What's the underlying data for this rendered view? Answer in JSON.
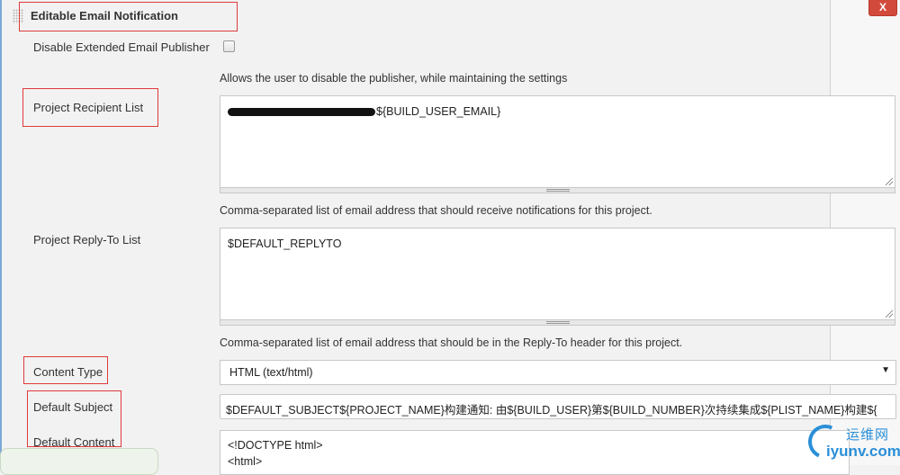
{
  "section": {
    "title": "Editable Email Notification",
    "delete_label": "X"
  },
  "disable_publisher": {
    "label": "Disable Extended Email Publisher",
    "checked": false,
    "help": "Allows the user to disable the publisher, while maintaining the settings"
  },
  "recipient_list": {
    "label": "Project Recipient List",
    "value_suffix": "${BUILD_USER_EMAIL}",
    "help": "Comma-separated list of email address that should receive notifications for this project."
  },
  "reply_to_list": {
    "label": "Project Reply-To List",
    "value": "$DEFAULT_REPLYTO",
    "help": "Comma-separated list of email address that should be in the Reply-To header for this project."
  },
  "content_type": {
    "label": "Content Type",
    "selected": "HTML (text/html)",
    "arrow": "▼"
  },
  "default_subject": {
    "label": "Default Subject",
    "value": "$DEFAULT_SUBJECT${PROJECT_NAME}构建通知: 由${BUILD_USER}第${BUILD_NUMBER}次持续集成${PLIST_NAME}构建${"
  },
  "default_content": {
    "label": "Default Content",
    "value": "<!DOCTYPE html>\n<html>"
  },
  "watermark": {
    "cn": "运维网",
    "en": "iyunv.com"
  },
  "colors": {
    "highlight_box": "#e03a3a",
    "delete_button": "#d24a3c",
    "watermark": "#2a8fd8",
    "left_rule": "#7aa7d8"
  }
}
